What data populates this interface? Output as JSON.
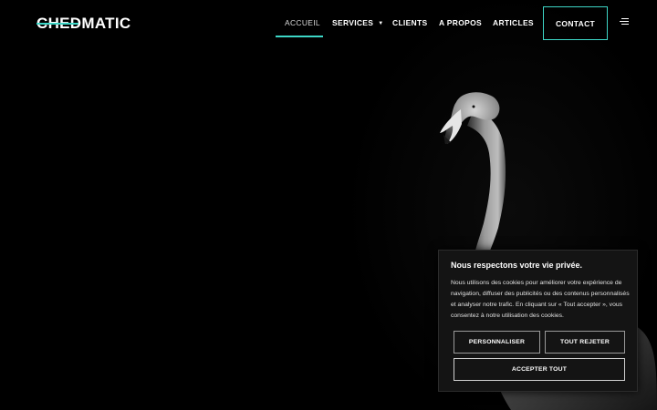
{
  "logo": {
    "text": "CHEDMATIC"
  },
  "nav": {
    "items": [
      {
        "label": "ACCUEIL"
      },
      {
        "label": "SERVICES"
      },
      {
        "label": "CLIENTS"
      },
      {
        "label": "A PROPOS"
      },
      {
        "label": "ARTICLES"
      }
    ],
    "contact_label": "CONTACT",
    "menu_icon": "hamburger-menu-icon",
    "services_caret": "chevron-down-icon"
  },
  "hero": {
    "image": "flamingo-photo"
  },
  "cookie_banner": {
    "title": "Nous respectons votre vie privée.",
    "text": "Nous utilisons des cookies pour améliorer votre expérience de navigation, diffuser des publicités ou des contenus personnalisés et analyser notre trafic. En cliquant sur « Tout accepter », vous consentez à notre utilisation des cookies.",
    "customize_label": "PERSONNALISER",
    "reject_label": "TOUT REJETER",
    "accept_label": "ACCEPTER TOUT"
  },
  "colors": {
    "accent": "#3dd6c6",
    "background": "#000000",
    "panel": "#141414"
  }
}
